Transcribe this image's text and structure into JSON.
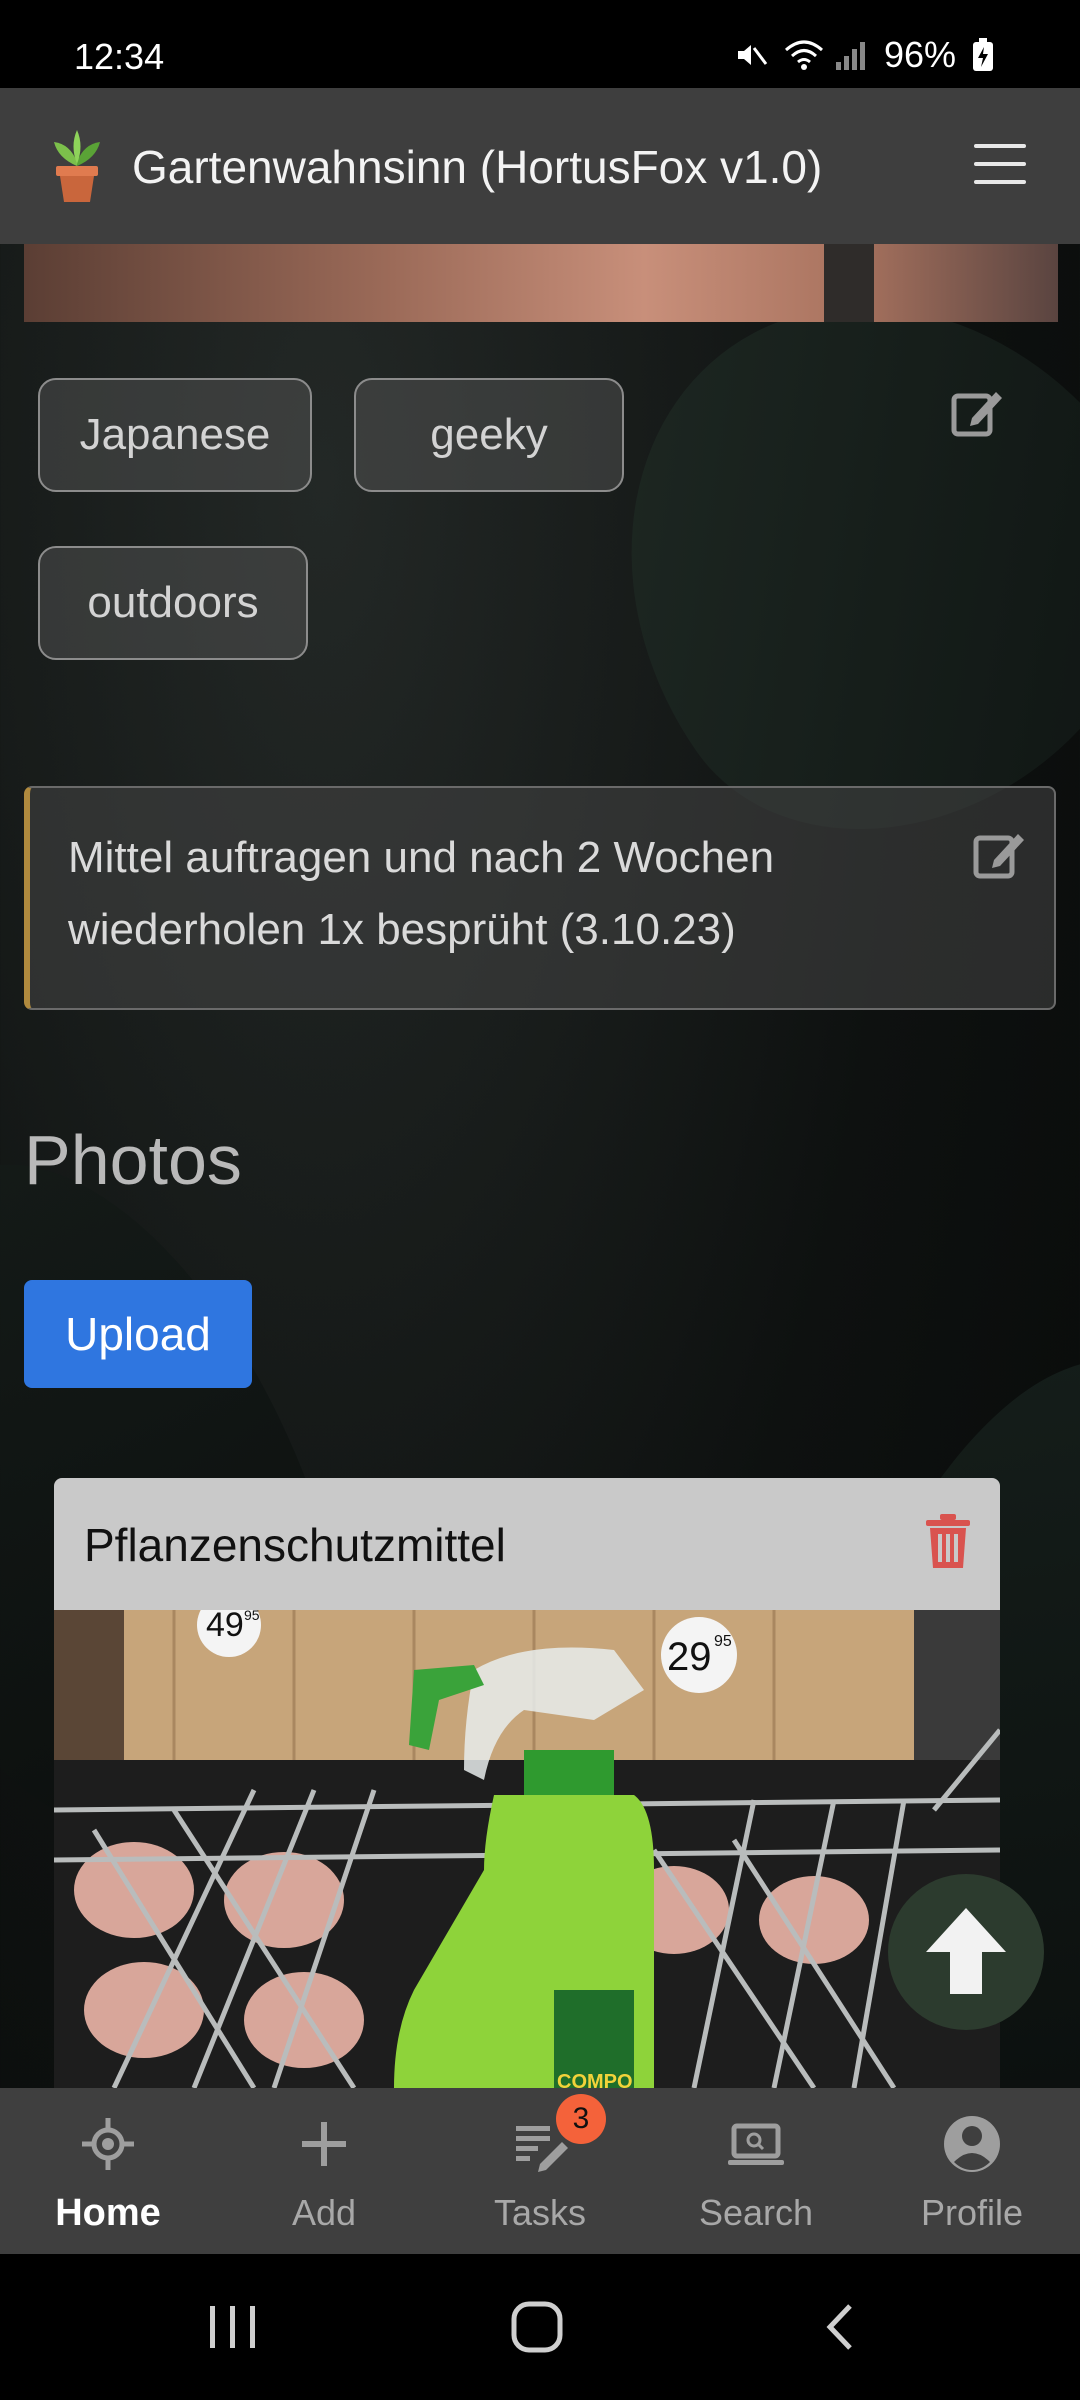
{
  "status_bar": {
    "time": "12:34",
    "battery": "96%"
  },
  "header": {
    "title": "Gartenwahnsinn (HortusFox v1.0)"
  },
  "tags": [
    {
      "label": "Japanese"
    },
    {
      "label": "geeky"
    },
    {
      "label": "outdoors"
    }
  ],
  "notes": {
    "text": "Mittel auftragen und nach 2 Wochen wiederholen 1x besprüht (3.10.23)"
  },
  "photos": {
    "heading": "Photos",
    "upload_label": "Upload",
    "items": [
      {
        "title": "Pflanzenschutzmittel"
      }
    ]
  },
  "photo_labels": {
    "price_left": "49",
    "price_left_cents": "95",
    "price_right": "29",
    "price_right_cents": "95",
    "brand": "COMPO"
  },
  "bottom_nav": [
    {
      "label": "Home",
      "icon": "home-target-icon",
      "active": true
    },
    {
      "label": "Add",
      "icon": "plus-icon"
    },
    {
      "label": "Tasks",
      "icon": "tasks-icon",
      "badge": "3"
    },
    {
      "label": "Search",
      "icon": "search-laptop-icon"
    },
    {
      "label": "Profile",
      "icon": "profile-icon"
    }
  ],
  "colors": {
    "accent": "#2f76e0",
    "note_border": "#b08a3e",
    "badge": "#f4623a",
    "trash": "#d9534f"
  }
}
